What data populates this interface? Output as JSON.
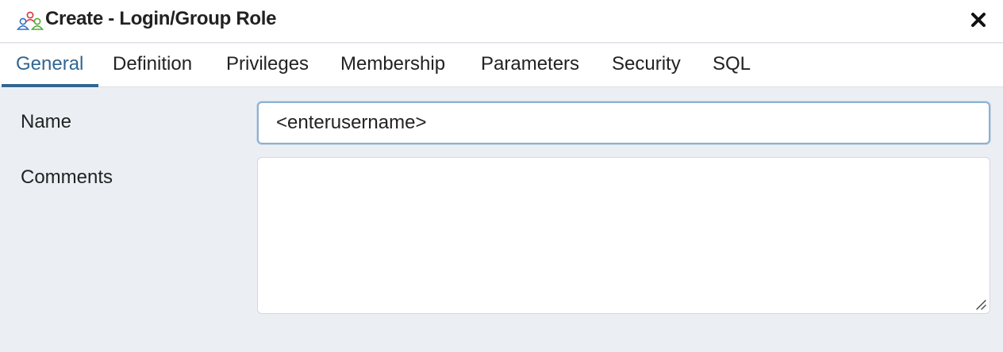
{
  "dialog": {
    "title": "Create - Login/Group Role",
    "title_icon": "group-role-icon",
    "close_icon": "close-icon"
  },
  "tabs": [
    {
      "label": "General",
      "active": true
    },
    {
      "label": "Definition",
      "active": false
    },
    {
      "label": "Privileges",
      "active": false
    },
    {
      "label": "Membership",
      "active": false
    },
    {
      "label": "Parameters",
      "active": false
    },
    {
      "label": "Security",
      "active": false
    },
    {
      "label": "SQL",
      "active": false
    }
  ],
  "form": {
    "name_label": "Name",
    "name_value": "<enterusername>",
    "comments_label": "Comments",
    "comments_value": ""
  },
  "colors": {
    "accent": "#326690",
    "panel_background": "#ebeff4",
    "header_background": "#ffffff"
  }
}
